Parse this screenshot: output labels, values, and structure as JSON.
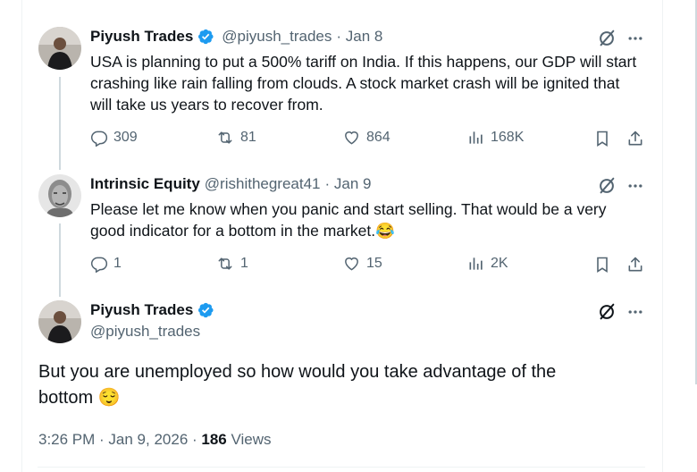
{
  "tweets": [
    {
      "name": "Piyush Trades",
      "handle": "@piyush_trades",
      "date": "· Jan 8",
      "verified": true,
      "text": "USA is planning to put a 500% tariff on India. If this happens, our GDP will start crashing like rain falling from clouds. A stock market crash will be ignited that will take us years to recover from.",
      "replies": "309",
      "reposts": "81",
      "likes": "864",
      "views": "168K"
    },
    {
      "name": "Intrinsic Equity",
      "handle": "@rishithegreat41",
      "date": "· Jan 9",
      "verified": false,
      "text": "Please let me know when you panic and start selling.  That would be a very good indicator for a bottom in the market.😂",
      "replies": "1",
      "reposts": "1",
      "likes": "15",
      "views": "2K"
    }
  ],
  "main_tweet": {
    "name": "Piyush Trades",
    "handle": "@piyush_trades",
    "verified": true,
    "text": "But you are unemployed so how would you take advantage of the bottom 😌",
    "time_date": "3:26 PM · Jan 9, 2026 ·",
    "views_count": "186",
    "views_label": "Views"
  },
  "colors": {
    "accent": "#1d9bf0",
    "secondary_text": "#536471",
    "primary_text": "#0f1419",
    "thread_line": "#cfd9de"
  }
}
